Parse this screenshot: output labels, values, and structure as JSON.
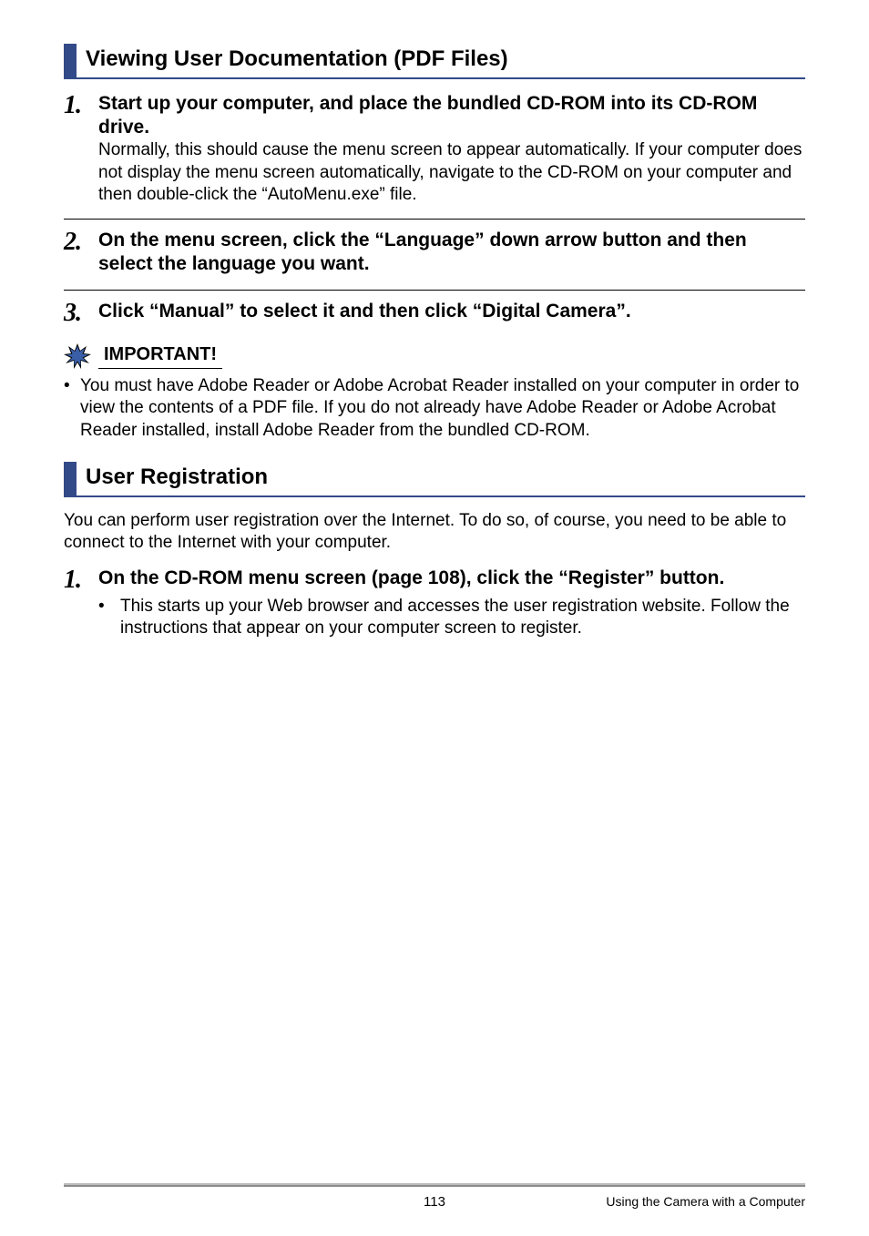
{
  "section1": {
    "heading": "Viewing User Documentation (PDF Files)",
    "steps": [
      {
        "num": "1.",
        "title": "Start up your computer, and place the bundled CD-ROM into its CD-ROM drive.",
        "body": "Normally, this should cause the menu screen to appear automatically. If your computer does not display the menu screen automatically, navigate to the CD-ROM on your computer and then double-click the “AutoMenu.exe” file."
      },
      {
        "num": "2.",
        "title": "On the menu screen, click the “Language” down arrow button and then select the language you want.",
        "body": ""
      },
      {
        "num": "3.",
        "title": "Click “Manual” to select it and then click “Digital Camera”.",
        "body": ""
      }
    ],
    "important": {
      "label": "IMPORTANT!",
      "text": "You must have Adobe Reader or Adobe Acrobat Reader installed on your computer in order to view the contents of a PDF file. If you do not already have Adobe Reader or Adobe Acrobat Reader installed, install Adobe Reader from the bundled CD-ROM."
    }
  },
  "section2": {
    "heading": "User Registration",
    "intro": "You can perform user registration over the Internet. To do so, of course, you need to be able to connect to the Internet with your computer.",
    "steps": [
      {
        "num": "1.",
        "title": "On the CD-ROM menu screen (page 108), click the “Register” button.",
        "sub": "This starts up your Web browser and accesses the user registration website. Follow the instructions that appear on your computer screen to register."
      }
    ]
  },
  "footer": {
    "page": "113",
    "section": "Using the Camera with a Computer"
  }
}
